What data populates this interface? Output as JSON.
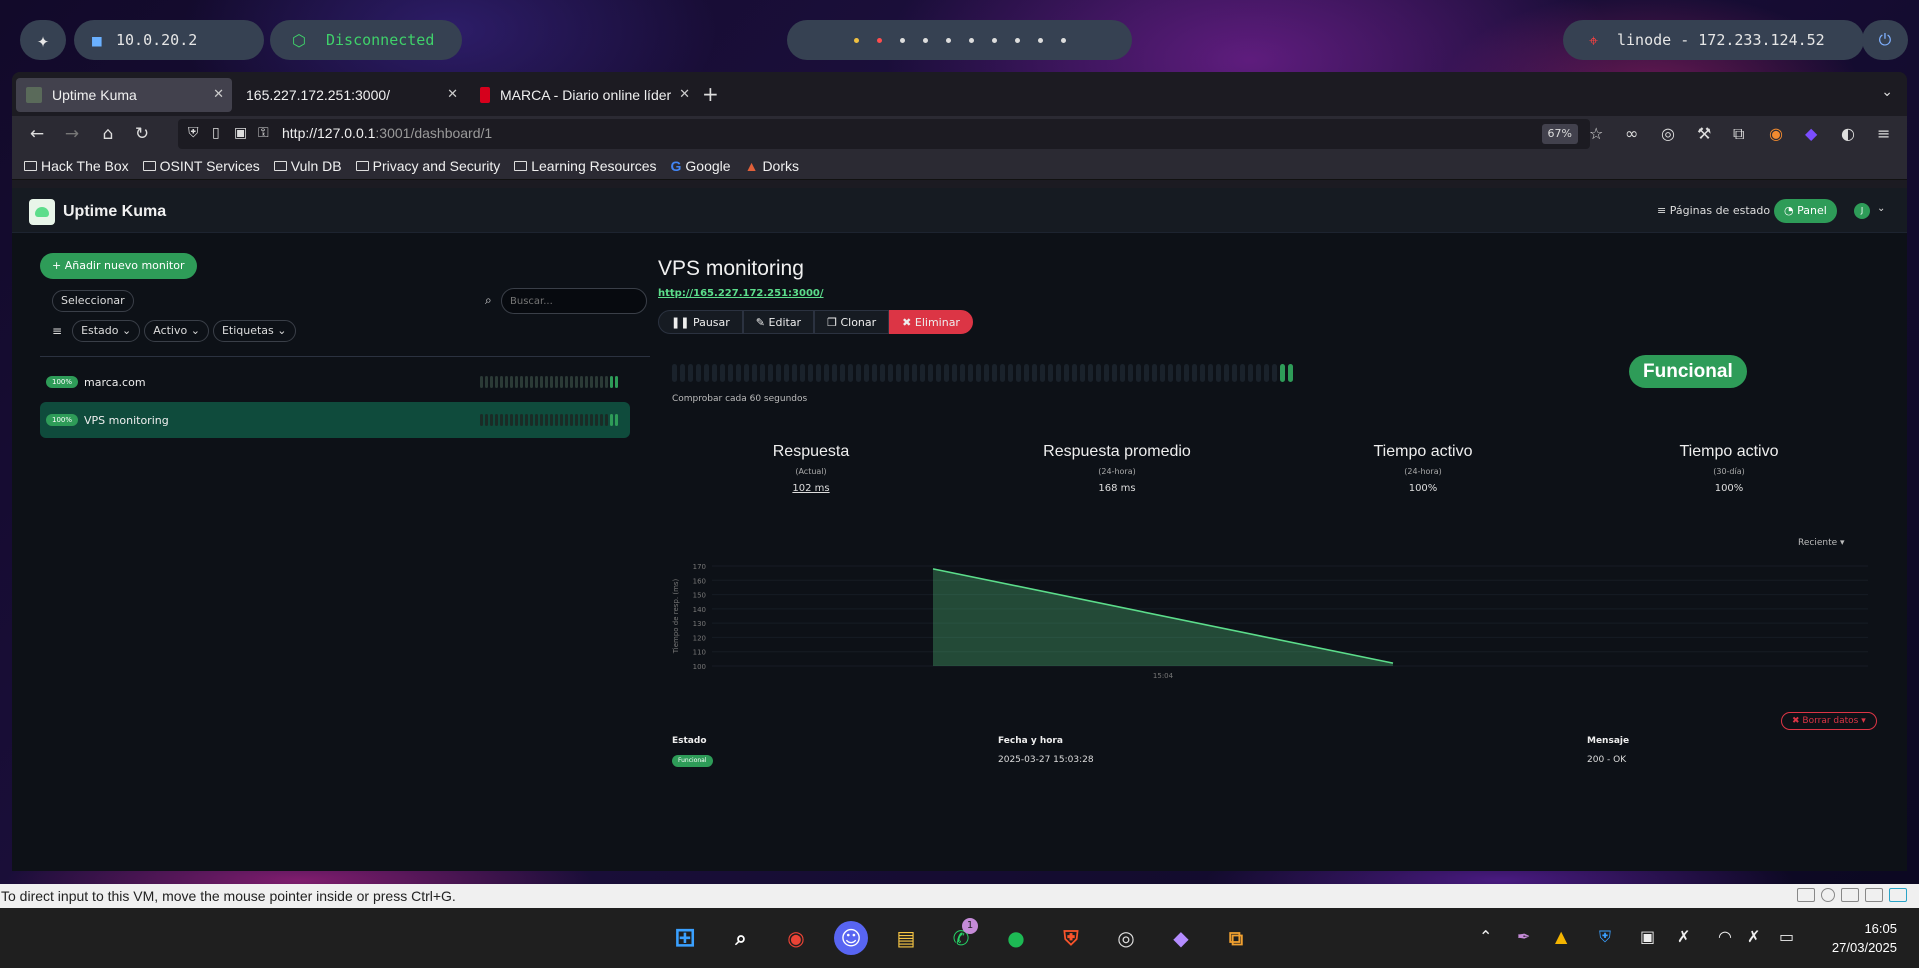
{
  "vm_bar": {
    "ip": "10.0.20.2",
    "vpn_status": "Disconnected",
    "target": "linode - 172.233.124.52"
  },
  "browser": {
    "tabs": [
      {
        "label": "Uptime Kuma",
        "favicon_color": "#5a6a5a",
        "active": true
      },
      {
        "label": "165.227.172.251:3000/",
        "favicon_color": "",
        "active": false
      },
      {
        "label": "MARCA - Diario online líder",
        "favicon_color": "#d6001c",
        "active": false
      }
    ],
    "url_host": "http://127.0.0.1",
    "url_rest": ":3001/dashboard/1",
    "zoom": "67%",
    "bookmarks": [
      {
        "label": "Hack The Box",
        "icon": "folder-icon"
      },
      {
        "label": "OSINT Services",
        "icon": "folder-icon"
      },
      {
        "label": "Vuln DB",
        "icon": "folder-icon"
      },
      {
        "label": "Privacy and Security",
        "icon": "folder-icon"
      },
      {
        "label": "Learning Resources",
        "icon": "folder-icon"
      },
      {
        "label": "Google",
        "icon": "google-icon"
      },
      {
        "label": "Dorks",
        "icon": "dorks-icon"
      }
    ]
  },
  "app": {
    "brand": "Uptime Kuma",
    "status_pages": "Páginas de estado",
    "panel": "Panel",
    "avatar": "J"
  },
  "sidebar": {
    "add_monitor": "+ Añadir nuevo monitor",
    "select": "Seleccionar",
    "search_placeholder": "Buscar...",
    "filters": [
      "Estado",
      "Activo",
      "Etiquetas"
    ],
    "monitors": [
      {
        "name": "marca.com",
        "uptime": "100%",
        "selected": false
      },
      {
        "name": "VPS monitoring",
        "uptime": "100%",
        "selected": true
      }
    ]
  },
  "monitor": {
    "title": "VPS monitoring",
    "url": "http://165.227.172.251:3000/",
    "actions": {
      "pause": "Pausar",
      "edit": "Editar",
      "clone": "Clonar",
      "delete": "Eliminar"
    },
    "status": "Funcional",
    "check_interval": "Comprobar cada 60 segundos",
    "stats": [
      {
        "title": "Respuesta",
        "sub": "(Actual)",
        "value": "102 ms"
      },
      {
        "title": "Respuesta promedio",
        "sub": "(24-hora)",
        "value": "168 ms"
      },
      {
        "title": "Tiempo activo",
        "sub": "(24-hora)",
        "value": "100%"
      },
      {
        "title": "Tiempo activo",
        "sub": "(30-día)",
        "value": "100%"
      }
    ],
    "chart_range": "Reciente",
    "delete_data": "Borrar datos",
    "table": {
      "headers": [
        "Estado",
        "Fecha y hora",
        "Mensaje"
      ],
      "rows": [
        {
          "status": "Funcional",
          "datetime": "2025-03-27 15:03:28",
          "message": "200 - OK"
        }
      ]
    }
  },
  "chart_data": {
    "type": "area",
    "title": "",
    "xlabel": "",
    "ylabel": "Tiempo de resp. (ms)",
    "y_ticks": [
      "170",
      "160",
      "150",
      "140",
      "130",
      "120",
      "110",
      "100"
    ],
    "x_ticks": [
      "15:04"
    ],
    "ylim": [
      100,
      170
    ],
    "series": [
      {
        "name": "",
        "color": "#5cdd8b",
        "x": [
          0,
          1
        ],
        "values": [
          168,
          102
        ]
      }
    ],
    "grid": true
  },
  "vm_status": "To direct input to this VM, move the mouse pointer inside or press Ctrl+G.",
  "taskbar": {
    "whatsapp_badge": "1",
    "time": "16:05",
    "date": "27/03/2025"
  }
}
